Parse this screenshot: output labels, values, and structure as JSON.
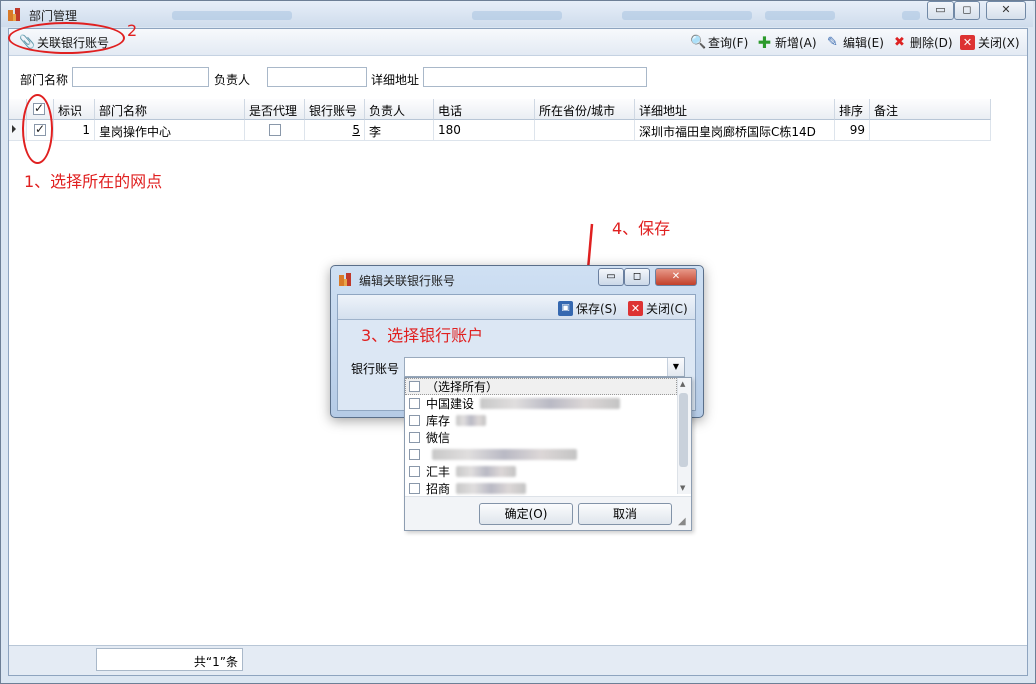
{
  "window": {
    "title": "部门管理",
    "controls": {
      "minimize": "▭",
      "maximize": "◻",
      "close": "✕"
    }
  },
  "toolbar": {
    "link_bank_account": "关联银行账号",
    "query": "查询(F)",
    "add": "新增(A)",
    "edit": "编辑(E)",
    "delete": "删除(D)",
    "close": "关闭(X)"
  },
  "filters": {
    "dept_name_label": "部门名称",
    "owner_label": "负责人",
    "address_label": "详细地址",
    "dept_name_value": "",
    "owner_value": "",
    "address_value": ""
  },
  "grid": {
    "columns": [
      "标识",
      "部门名称",
      "是否代理",
      "银行账号",
      "负责人",
      "电话",
      "所在省份/城市",
      "详细地址",
      "排序",
      "备注"
    ],
    "rows": [
      {
        "selected": true,
        "id": "1",
        "dept_name": "皇岗操作中心",
        "is_agent": false,
        "bank_account": "5",
        "owner": "李",
        "phone": "180",
        "province_city": "",
        "address": "深圳市福田皇岗廊桥国际C栋14D",
        "sort": "99",
        "remark": ""
      }
    ]
  },
  "status": {
    "record_count": "共“1”条"
  },
  "annotations": {
    "step1": "1、选择所在的网点",
    "step2": "2",
    "step3": "3、选择银行账户",
    "step4": "4、保存"
  },
  "dialog": {
    "title": "编辑关联银行账号",
    "save": "保存(S)",
    "close": "关闭(C)",
    "bank_account_label": "银行账号",
    "bank_account_value": ""
  },
  "dropdown": {
    "items": [
      {
        "label": "（选择所有）",
        "checked": false
      },
      {
        "label": "中国建设",
        "checked": false
      },
      {
        "label": "库存",
        "checked": false
      },
      {
        "label": "微信",
        "checked": false
      },
      {
        "label": "",
        "checked": false
      },
      {
        "label": "汇丰",
        "checked": false
      },
      {
        "label": "招商",
        "checked": false
      }
    ],
    "ok": "确定(O)",
    "cancel": "取消"
  },
  "colors": {
    "annotation_red": "#e02020",
    "window_blue": "#dbe6f2"
  }
}
